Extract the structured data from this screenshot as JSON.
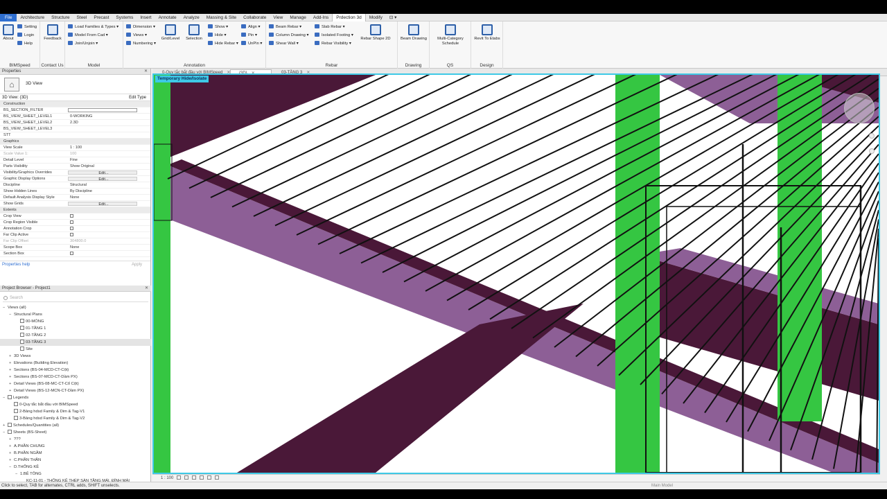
{
  "menu": [
    "File",
    "Architecture",
    "Structure",
    "Steel",
    "Precast",
    "Systems",
    "Insert",
    "Annotate",
    "Analyze",
    "Massing & Site",
    "Collaborate",
    "View",
    "Manage",
    "Add-Ins",
    "Prdection 3d",
    "Modify",
    "⊡ ▾"
  ],
  "ribbon": {
    "bimspeed": {
      "about": "About",
      "setting": "Setting",
      "login": "Login",
      "help": "Help",
      "title": "BIMSpeed"
    },
    "contact": {
      "feedback": "Feedback",
      "title": "Contact Us"
    },
    "model": {
      "load_families": "Load Families & Types ▾",
      "model_from_cad": "Model From Cad ▾",
      "join_unjoin": "Join/Unjoin ▾",
      "title": "Model"
    },
    "annotation": {
      "dimension": "Dimension ▾",
      "views": "Views ▾",
      "numbering": "Numbering ▾",
      "grid_level": "Grid/Level",
      "selection": "Selection",
      "show": "Show ▾",
      "hide": "Hide ▾",
      "hide_rebar": "Hide Rebar ▾",
      "align": "Align ▾",
      "pin": "Pin ▾",
      "unpin": "UnPin ▾",
      "title": "Annotation"
    },
    "rebar": {
      "beam_rebar": "Beam Rebar ▾",
      "column_drawing": "Column Drawing ▾",
      "shear_wall": "Shear Wall ▾",
      "slab_rebar": "Slab Rebar ▾",
      "isolated_footing": "Isolated Footing ▾",
      "rebar_visibility": "Rebar Visibility ▾",
      "rebar_shape": "Rebar Shape 2D",
      "title": "Rebar"
    },
    "drawing": {
      "beam_drawing": "Beam Drawing",
      "title": "Drawing"
    },
    "qs": {
      "multi_category": "Multi-Category Schedule",
      "title": "QS"
    },
    "design": {
      "revit_to_etabs": "Revit To Etabs",
      "title": "Design"
    }
  },
  "properties": {
    "title": "Properties",
    "type_name": "3D View",
    "view_selector": "3D View: {3D}",
    "edit_type": "Edit Type",
    "rows": [
      {
        "k": "Construction",
        "v": "",
        "cat": true
      },
      {
        "k": "BS_SECTION_FILTER",
        "v": ""
      },
      {
        "k": "BS_VIEW_SHEET_LEVEL1",
        "v": "0-WORKING"
      },
      {
        "k": "BS_VIEW_SHEET_LEVEL2",
        "v": "2.3D"
      },
      {
        "k": "BS_VIEW_SHEET_LEVEL3",
        "v": ""
      },
      {
        "k": "STT",
        "v": ""
      },
      {
        "k": "Graphics",
        "v": "",
        "cat": true
      },
      {
        "k": "View Scale",
        "v": "1 : 100"
      },
      {
        "k": "Scale Value    1:",
        "v": "100",
        "dim": true
      },
      {
        "k": "Detail Level",
        "v": "Fine"
      },
      {
        "k": "Parts Visibility",
        "v": "Show Original"
      },
      {
        "k": "Visibility/Graphics Overrides",
        "v": "Edit...",
        "btn": true
      },
      {
        "k": "Graphic Display Options",
        "v": "Edit...",
        "btn": true
      },
      {
        "k": "Discipline",
        "v": "Structural"
      },
      {
        "k": "Show Hidden Lines",
        "v": "By Discipline"
      },
      {
        "k": "Default Analysis Display Style",
        "v": "None"
      },
      {
        "k": "Show Grids",
        "v": "Edit...",
        "btn": true
      },
      {
        "k": "Extents",
        "v": "",
        "cat": true
      },
      {
        "k": "Crop View",
        "v": "",
        "box": true
      },
      {
        "k": "Crop Region Visible",
        "v": "",
        "box": true
      },
      {
        "k": "Annotation Crop",
        "v": "",
        "box": true
      },
      {
        "k": "Far Clip Active",
        "v": "",
        "box": true
      },
      {
        "k": "Far Clip Offset",
        "v": "304800.0",
        "dim": true
      },
      {
        "k": "Scope Box",
        "v": "None"
      },
      {
        "k": "Section Box",
        "v": "",
        "box": true
      }
    ],
    "help": "Properties help",
    "apply": "Apply"
  },
  "browser": {
    "title": "Project Browser - Project1",
    "search": "Search",
    "nodes": [
      {
        "t": "Views (all)",
        "l": 0,
        "g": "−"
      },
      {
        "t": "Structural Plans",
        "l": 1,
        "g": "−"
      },
      {
        "t": "00-MÓNG",
        "l": 2,
        "g": "",
        "f": true
      },
      {
        "t": "01-TẦNG 1",
        "l": 2,
        "g": "",
        "f": true
      },
      {
        "t": "02-TẦNG 2",
        "l": 2,
        "g": "",
        "f": true
      },
      {
        "t": "03-TẦNG 3",
        "l": 2,
        "g": "",
        "f": true,
        "sel": true
      },
      {
        "t": "Site",
        "l": 2,
        "g": "",
        "f": true
      },
      {
        "t": "3D Views",
        "l": 1,
        "g": "+"
      },
      {
        "t": "Elevations (Building Elevation)",
        "l": 1,
        "g": "+"
      },
      {
        "t": "Sections (BS-04-MCD-CT-Cột)",
        "l": 1,
        "g": "+"
      },
      {
        "t": "Sections (BS-07-MCD-CT-Dầm PX)",
        "l": 1,
        "g": "+"
      },
      {
        "t": "Detail Views (BS-08-MC-CT-Cổ Cột)",
        "l": 1,
        "g": "+"
      },
      {
        "t": "Detail Views (BS-12-MCN-CT-Dầm PX)",
        "l": 1,
        "g": "+"
      },
      {
        "t": "Legends",
        "l": 0,
        "g": "−",
        "f": true
      },
      {
        "t": "0-Quy tắc bắt đầu với BIMSpeed",
        "l": 1,
        "g": "",
        "f": true
      },
      {
        "t": "2-Bảng hdsd Family & Dim & Tag-V1",
        "l": 1,
        "g": "",
        "f": true
      },
      {
        "t": "3-Bảng hdsd Family & Dim & Tag-V2",
        "l": 1,
        "g": "",
        "f": true
      },
      {
        "t": "Schedules/Quantities (all)",
        "l": 0,
        "g": "+",
        "f": true
      },
      {
        "t": "Sheets (BS-Sheet)",
        "l": 0,
        "g": "−",
        "f": true
      },
      {
        "t": "???",
        "l": 1,
        "g": "+"
      },
      {
        "t": "A.PHẦN CHUNG",
        "l": 1,
        "g": "+"
      },
      {
        "t": "B.PHẦN NGẦM",
        "l": 1,
        "g": "+"
      },
      {
        "t": "C.PHẦN THÂN",
        "l": 1,
        "g": "+"
      },
      {
        "t": "D.THỐNG KÊ",
        "l": 1,
        "g": "−"
      },
      {
        "t": "1.BÊ TÔNG",
        "l": 2,
        "g": "−"
      },
      {
        "t": "KC-11-01 - THỐNG KÊ THÉP SÀN TẦNG MÁI, ĐỈNH MÁI",
        "l": 3,
        "g": ""
      },
      {
        "t": "KC-11-02 - THỐNG KÊ BÊ TÔNG - TỜ 1",
        "l": 3,
        "g": ""
      }
    ]
  },
  "tabs": [
    {
      "label": "0-Quy tắc bắt đầu với BIMSpeed",
      "active": false
    },
    {
      "label": "{3D}",
      "active": true
    },
    {
      "label": "03-TẦNG 3",
      "active": false
    }
  ],
  "viewport": {
    "badge": "Temporary Hide/Isolate",
    "scale": "1 : 100"
  },
  "status": {
    "text": "Click to select, TAB for alternates, CTRL adds, SHIFT unselects.",
    "model": "Main Model"
  },
  "colors": {
    "beam": "#8d5f96",
    "beam_dark": "#4a1838",
    "column": "#35c642",
    "highlight": "#3ec9e6"
  }
}
